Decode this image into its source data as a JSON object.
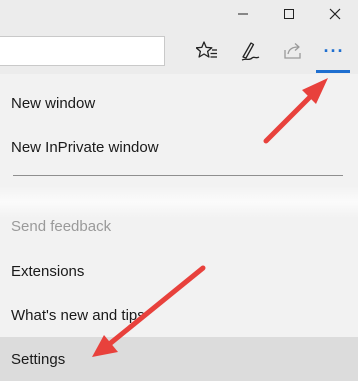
{
  "window_controls": {
    "minimize_icon": "minimize-icon",
    "maximize_icon": "maximize-icon",
    "close_icon": "close-icon"
  },
  "toolbar": {
    "address_value": "",
    "icons": [
      "favorites-star-icon",
      "pen-annotate-icon",
      "share-icon",
      "more-ellipsis-icon"
    ],
    "more_label": "···"
  },
  "menu": {
    "items": [
      {
        "label": "New window"
      },
      {
        "label": "New InPrivate window"
      },
      {
        "label": "Send feedback"
      },
      {
        "label": "Extensions"
      },
      {
        "label": "What's new and tips"
      },
      {
        "label": "Settings"
      }
    ]
  },
  "colors": {
    "accent": "#1f6fd0",
    "arrow": "#e8413c",
    "menu_bg": "#f2f2f2",
    "hover_bg": "#dcdcdc"
  }
}
